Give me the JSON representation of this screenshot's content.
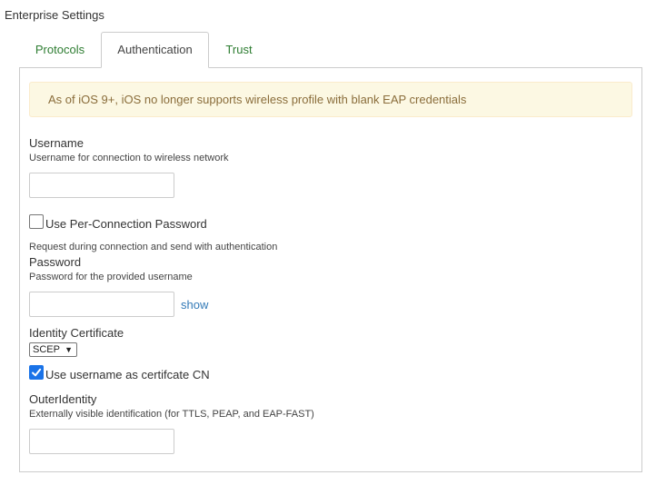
{
  "section": {
    "title": "Enterprise Settings"
  },
  "tabs": [
    {
      "label": "Protocols"
    },
    {
      "label": "Authentication",
      "active": true
    },
    {
      "label": "Trust"
    }
  ],
  "alert": {
    "text": "As of iOS 9+, iOS no longer supports wireless profile with blank EAP credentials"
  },
  "username": {
    "label": "Username",
    "help": "Username for connection to wireless network",
    "value": ""
  },
  "per_connection_password": {
    "label": "Use Per-Connection Password",
    "checked": false,
    "help": "Request during connection and send with authentication"
  },
  "password": {
    "label": "Password",
    "help": "Password for the provided username",
    "value": "",
    "show_label": "show"
  },
  "identity_certificate": {
    "label": "Identity Certificate",
    "selected": "SCEP",
    "caret": "▼"
  },
  "use_username_cn": {
    "label": "Use username as certifcate CN",
    "checked": true
  },
  "outer_identity": {
    "label": "OuterIdentity",
    "help": "Externally visible identification (for TTLS, PEAP, and EAP-FAST)",
    "value": ""
  },
  "colors": {
    "tab_link": "#2e7d32",
    "alert_bg": "#fcf8e3",
    "alert_text": "#8a6d3b",
    "link": "#337ab7",
    "checkbox": "#1a73e8"
  }
}
